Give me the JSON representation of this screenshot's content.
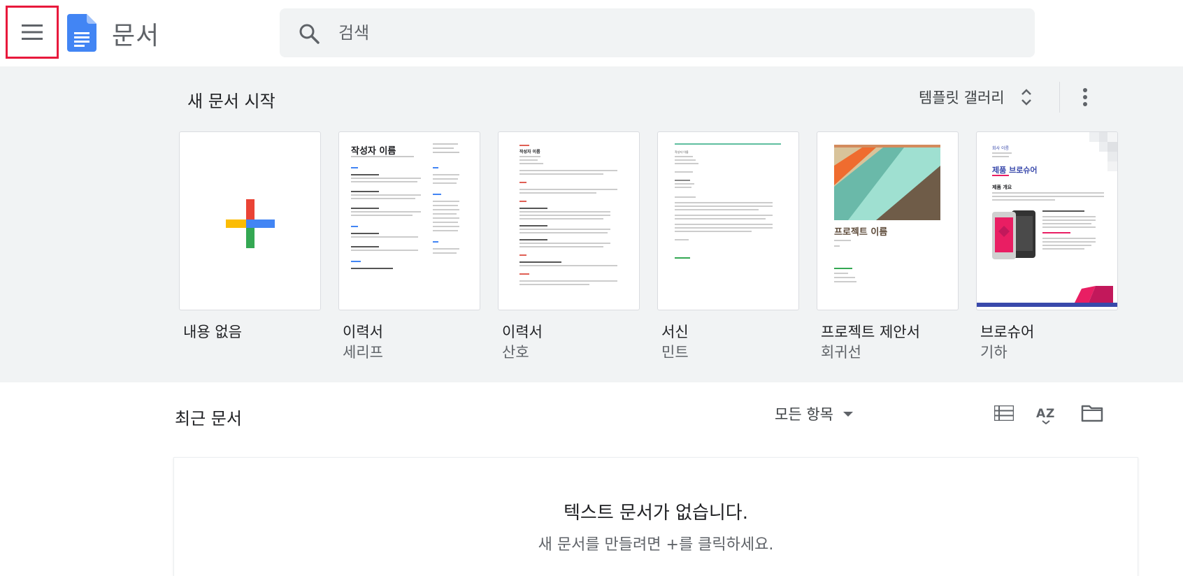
{
  "header": {
    "menu_icon": "hamburger-menu-icon",
    "logo_icon": "google-docs-logo-icon",
    "app_title": "문서",
    "search": {
      "icon": "search-icon",
      "placeholder": "검색"
    }
  },
  "templates": {
    "heading": "새 문서 시작",
    "gallery_label": "템플릿 갤러리",
    "gallery_icon": "unfold-more-icon",
    "more_icon": "more-vert-icon",
    "items": [
      {
        "name": "내용 없음",
        "sub": ""
      },
      {
        "name": "이력서",
        "sub": "세리프",
        "preview": {
          "title": "작성자 이름"
        }
      },
      {
        "name": "이력서",
        "sub": "산호",
        "preview": {
          "title": "작성자 이름"
        }
      },
      {
        "name": "서신",
        "sub": "민트",
        "preview": {
          "sender": "작성자 이름"
        }
      },
      {
        "name": "프로젝트 제안서",
        "sub": "회귀선",
        "preview": {
          "title": "프로젝트 이름"
        }
      },
      {
        "name": "브로슈어",
        "sub": "기하",
        "preview": {
          "company": "회사 이름",
          "title": "제품 브로슈어",
          "section": "제품 개요"
        }
      }
    ]
  },
  "recent": {
    "heading": "최근 문서",
    "filter_label": "모든 항목",
    "view_icons": [
      "list-view-icon",
      "sort-az-icon",
      "folder-icon"
    ],
    "empty_title": "텍스트 문서가 없습니다.",
    "empty_sub": "새 문서를 만들려면 +를 클릭하세요."
  },
  "colors": {
    "annotation": "#e8193c",
    "docs_blue": "#4285f4",
    "template_bg": "#f1f3f4"
  }
}
